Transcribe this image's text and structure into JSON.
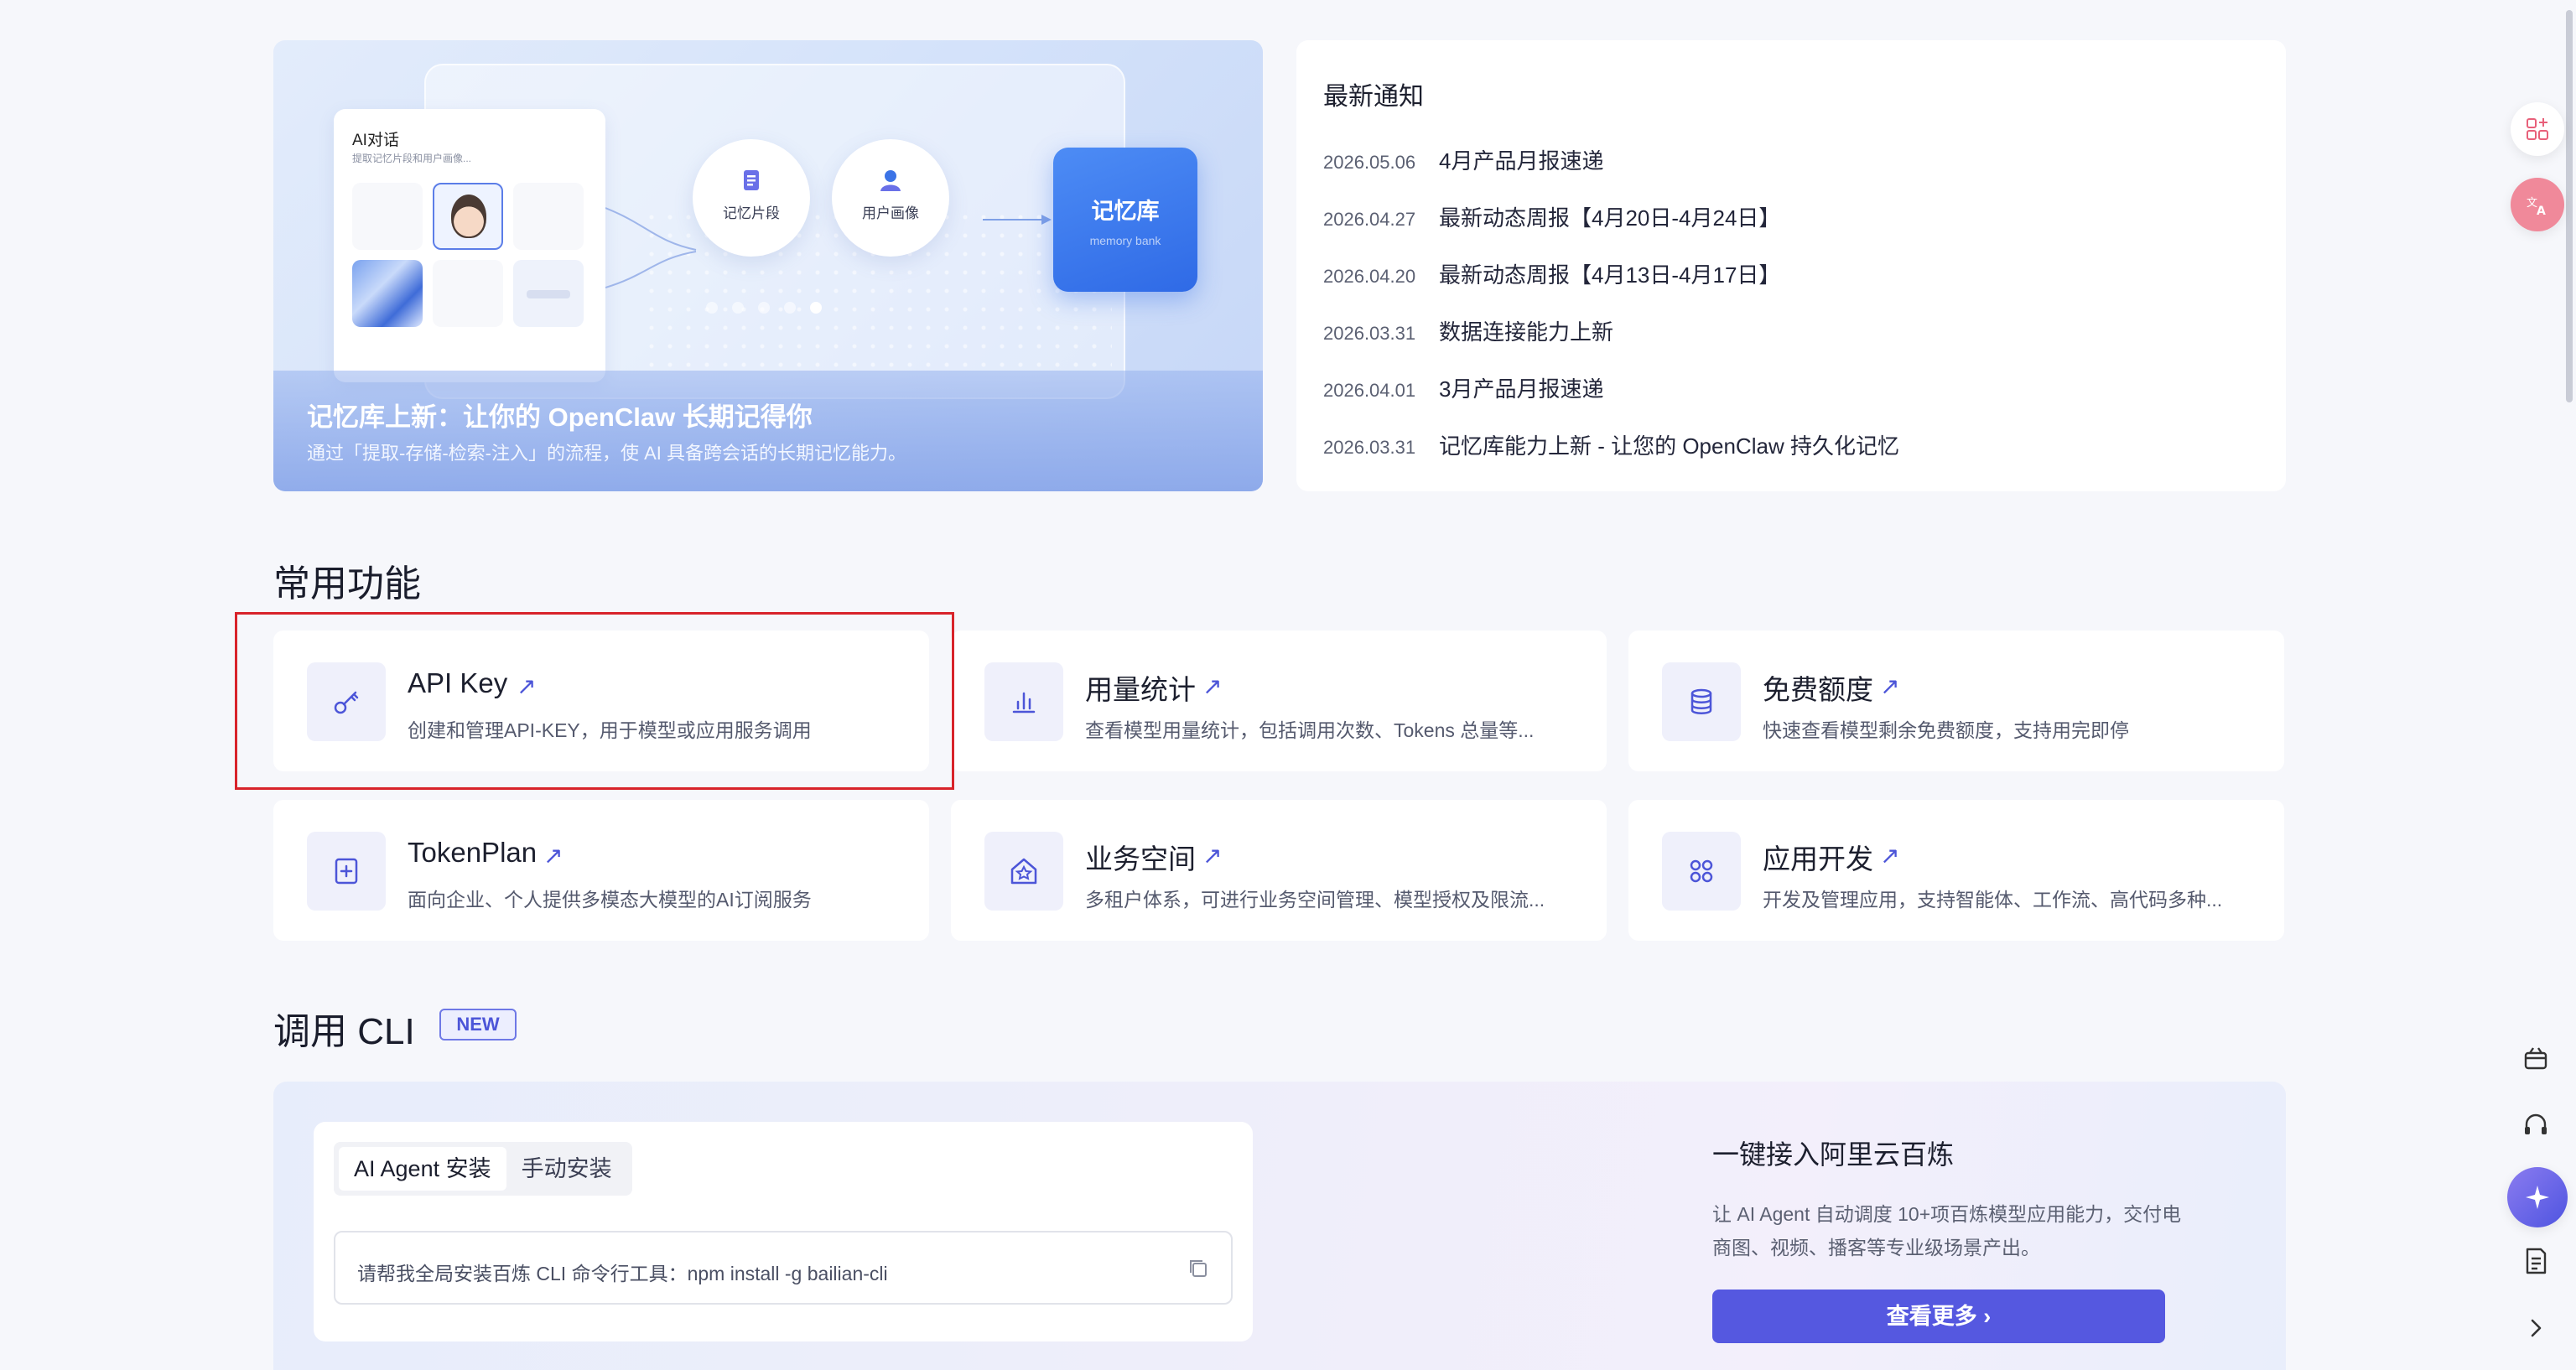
{
  "banner": {
    "chat_title": "AI对话",
    "chat_sub": "提取记忆片段和用户画像...",
    "node1_label": "记忆片段",
    "node2_label": "用户画像",
    "memory_title": "记忆库",
    "memory_sub": "memory bank",
    "title": "记忆库上新：让你的 OpenClaw 长期记得你",
    "subtitle": "通过「提取-存储-检索-注入」的流程，使 AI 具备跨会话的长期记忆能力。"
  },
  "notices": {
    "heading": "最新通知",
    "items": [
      {
        "date": "2026.05.06",
        "title": "4月产品月报速递"
      },
      {
        "date": "2026.04.27",
        "title": "最新动态周报【4月20日-4月24日】"
      },
      {
        "date": "2026.04.20",
        "title": "最新动态周报【4月13日-4月17日】"
      },
      {
        "date": "2026.03.31",
        "title": "数据连接能力上新"
      },
      {
        "date": "2026.04.01",
        "title": "3月产品月报速递"
      },
      {
        "date": "2026.03.31",
        "title": "记忆库能力上新 - 让您的 OpenClaw 持久化记忆"
      }
    ]
  },
  "features": {
    "heading": "常用功能",
    "arrow": "↗",
    "items": [
      {
        "title": "API Key",
        "desc": "创建和管理API-KEY，用于模型或应用服务调用",
        "icon": "key-icon"
      },
      {
        "title": "用量统计",
        "desc": "查看模型用量统计，包括调用次数、Tokens 总量等...",
        "icon": "bar-chart-icon"
      },
      {
        "title": "免费额度",
        "desc": "快速查看模型剩余免费额度，支持用完即停",
        "icon": "database-icon"
      },
      {
        "title": "TokenPlan",
        "desc": "面向企业、个人提供多模态大模型的AI订阅服务",
        "icon": "plan-icon"
      },
      {
        "title": "业务空间",
        "desc": "多租户体系，可进行业务空间管理、模型授权及限流...",
        "icon": "workspace-icon"
      },
      {
        "title": "应用开发",
        "desc": "开发及管理应用，支持智能体、工作流、高代码多种...",
        "icon": "app-grid-icon"
      }
    ]
  },
  "cli": {
    "heading": "调用 CLI",
    "badge": "NEW",
    "tabs": [
      "AI Agent 安装",
      "手动安装"
    ],
    "command": "请帮我全局安装百炼 CLI 命令行工具：npm install -g bailian-cli",
    "right_title": "一键接入阿里云百炼",
    "right_desc": "让 AI Agent 自动调度 10+项百炼模型应用能力，交付电商图、视频、播客等专业级场景产出。",
    "button": "查看更多 ›"
  },
  "colors": {
    "accent": "#5558e0",
    "highlight": "#d8232a",
    "memory": "#2f6ae6"
  }
}
